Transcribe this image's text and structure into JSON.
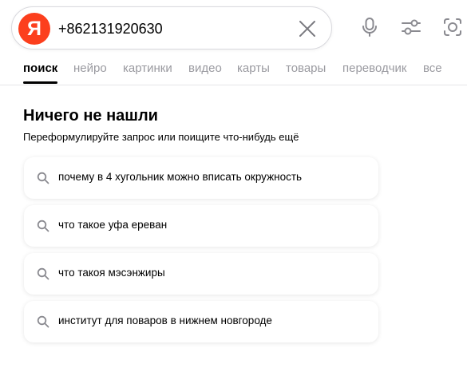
{
  "search": {
    "logo_glyph": "Я",
    "query": "+862131920630",
    "icons": {
      "clear": "close-icon",
      "voice": "microphone-icon",
      "settings": "filter-sliders-icon",
      "camera": "camera-lens-icon"
    }
  },
  "tabs": [
    {
      "label": "поиск",
      "active": true
    },
    {
      "label": "нейро",
      "active": false
    },
    {
      "label": "картинки",
      "active": false
    },
    {
      "label": "видео",
      "active": false
    },
    {
      "label": "карты",
      "active": false
    },
    {
      "label": "товары",
      "active": false
    },
    {
      "label": "переводчик",
      "active": false
    },
    {
      "label": "все",
      "active": false
    }
  ],
  "no_results": {
    "title": "Ничего не нашли",
    "subtitle": "Переформулируйте запрос или поищите что-нибудь ещё"
  },
  "suggestions": [
    {
      "text": "почему в 4 хугольник можно вписать окружность"
    },
    {
      "text": "что такое уфа ереван"
    },
    {
      "text": "что такоя мэсэнжиры"
    },
    {
      "text": "институт для поваров в нижнем новгороде"
    }
  ],
  "colors": {
    "brand": "#fc3f1d",
    "tab_inactive": "#9a9aa0",
    "icon_gray": "#8a8a90"
  }
}
